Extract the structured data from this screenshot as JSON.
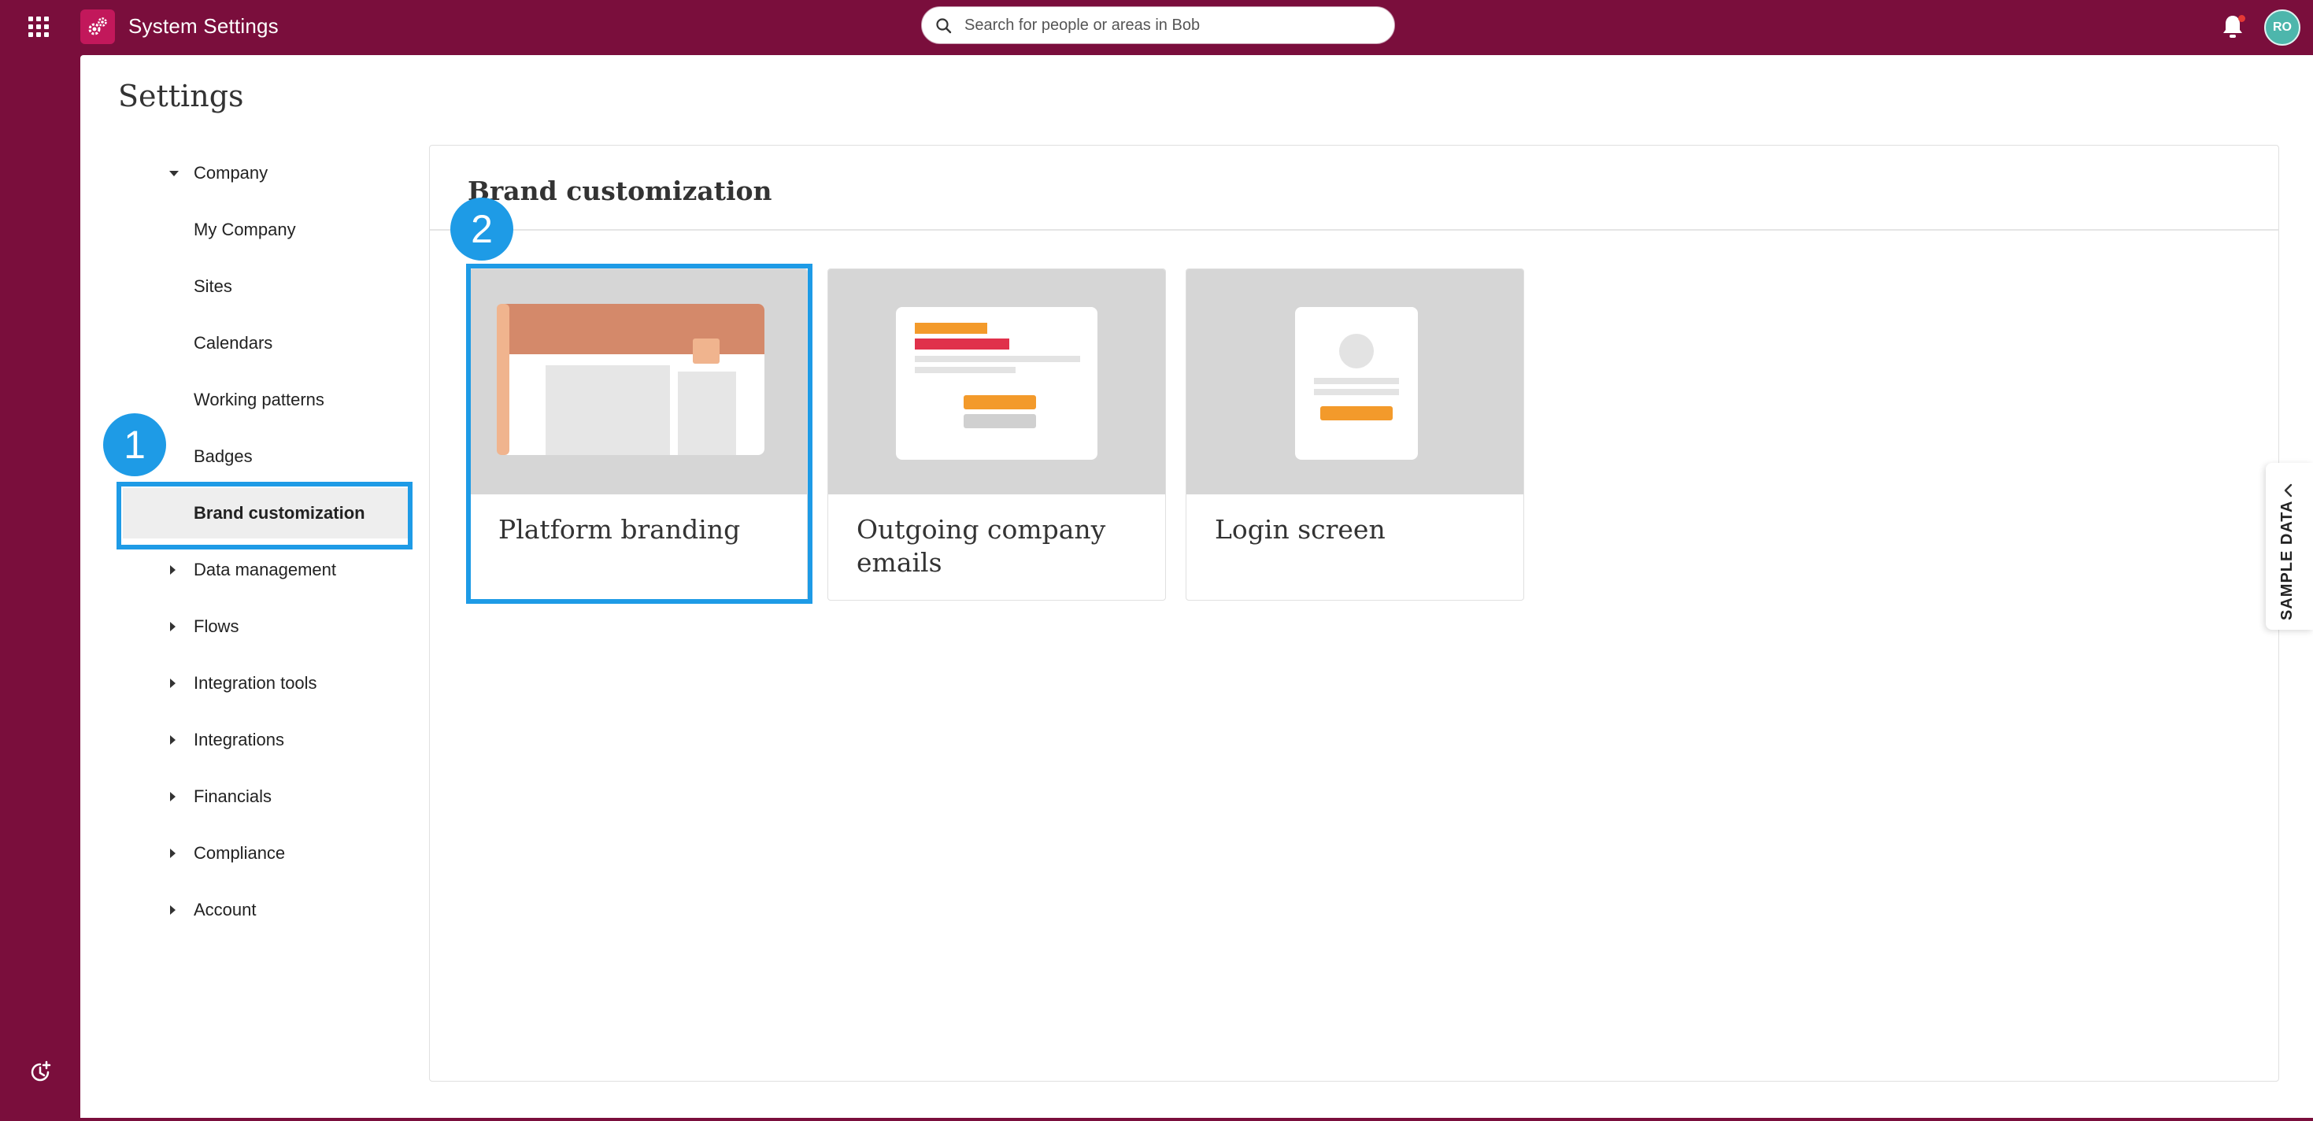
{
  "app": {
    "title": "System Settings",
    "search_placeholder": "Search for people or areas in Bob",
    "avatar_initials": "RO",
    "brand_color": "#7a0e3c",
    "accent_color": "#1e9be6"
  },
  "page": {
    "title": "Settings"
  },
  "sidebar": {
    "items": [
      {
        "label": "Company",
        "expanded": true,
        "has_caret": true
      },
      {
        "label": "My Company"
      },
      {
        "label": "Sites"
      },
      {
        "label": "Calendars"
      },
      {
        "label": "Working patterns"
      },
      {
        "label": "Badges"
      },
      {
        "label": "Brand customization",
        "selected": true
      },
      {
        "label": "Data management",
        "has_caret": true
      },
      {
        "label": "Flows",
        "has_caret": true
      },
      {
        "label": "Integration tools",
        "has_caret": true
      },
      {
        "label": "Integrations",
        "has_caret": true
      },
      {
        "label": "Financials",
        "has_caret": true
      },
      {
        "label": "Compliance",
        "has_caret": true
      },
      {
        "label": "Account",
        "has_caret": true
      }
    ]
  },
  "content": {
    "title": "Brand customization",
    "cards": [
      {
        "label": "Platform branding",
        "icon": "platform-branding-illustration"
      },
      {
        "label": "Outgoing company emails",
        "icon": "email-illustration"
      },
      {
        "label": "Login screen",
        "icon": "login-illustration"
      }
    ]
  },
  "annotations": {
    "step1": "1",
    "step2": "2"
  },
  "drawer": {
    "label": "SAMPLE DATA"
  }
}
